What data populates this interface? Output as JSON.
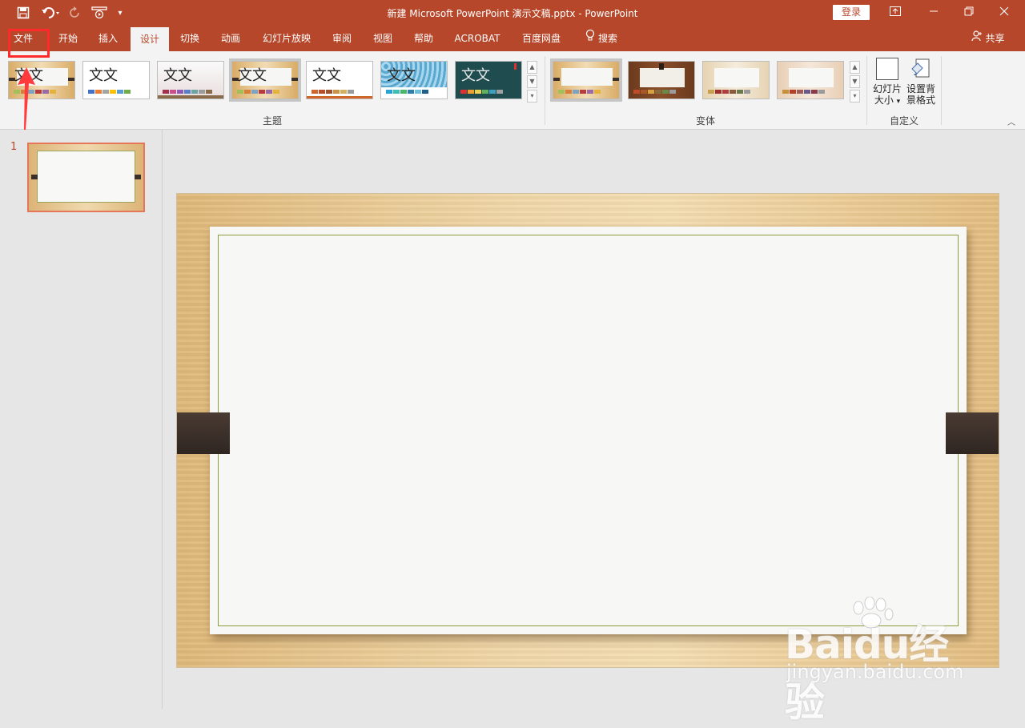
{
  "title_bar": {
    "title": "新建 Microsoft PowerPoint 演示文稿.pptx  -  PowerPoint",
    "login": "登录",
    "share": "共享",
    "colors": {
      "brand": "#b7472a"
    }
  },
  "quick_access": {
    "save_icon": "save-icon",
    "undo_icon": "undo-icon",
    "redo_icon": "redo-icon",
    "present_icon": "present-from-start-icon",
    "customize_icon": "customize-qat-icon"
  },
  "tabs": [
    {
      "label": "文件"
    },
    {
      "label": "开始"
    },
    {
      "label": "插入"
    },
    {
      "label": "设计"
    },
    {
      "label": "切换"
    },
    {
      "label": "动画"
    },
    {
      "label": "幻灯片放映"
    },
    {
      "label": "审阅"
    },
    {
      "label": "视图"
    },
    {
      "label": "帮助"
    },
    {
      "label": "ACROBAT"
    },
    {
      "label": "百度网盘"
    },
    {
      "label": "搜索"
    }
  ],
  "ribbon": {
    "themes_label": "主题",
    "variants_label": "变体",
    "customize_label": "自定义",
    "theme_text": "文文",
    "slide_size": "幻灯片\n大小",
    "slide_size_line1": "幻灯片",
    "slide_size_line2": "大小",
    "format_bg_line1": "设置背",
    "format_bg_line2": "景格式"
  },
  "slides_panel": {
    "slide_number": "1"
  },
  "watermark": {
    "logo": "Baidu经验",
    "url": "jingyan.baidu.com"
  }
}
